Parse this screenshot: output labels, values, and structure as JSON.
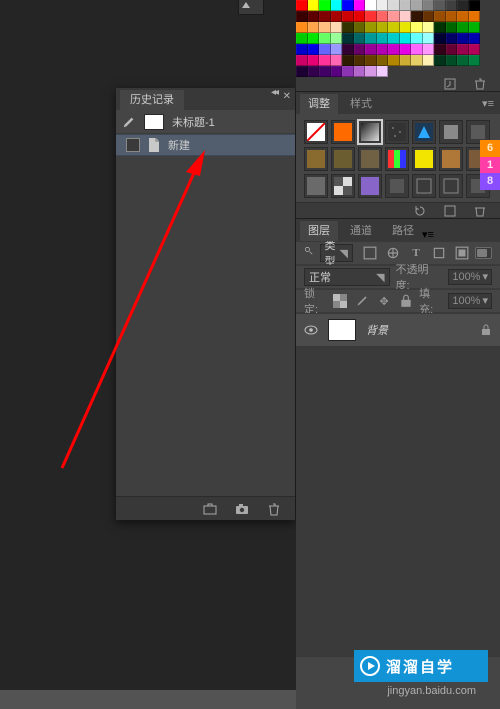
{
  "history": {
    "tab": "历史记录",
    "doc_title": "未标题-1",
    "item": {
      "label": "新建"
    }
  },
  "adjust_tabs": {
    "t1": "调整",
    "t2": "样式"
  },
  "layers_tabs": {
    "t1": "图层",
    "t2": "通道",
    "t3": "路径"
  },
  "filter_row": {
    "label": "类型"
  },
  "blend_row": {
    "mode": "正常",
    "opacity_lbl": "不透明度:",
    "opacity_val": "100%"
  },
  "lock_row": {
    "lbl": "锁定:",
    "fill_lbl": "填充:",
    "fill_val": "100%"
  },
  "layer0": {
    "name": "背景"
  },
  "badge": {
    "a": "6",
    "b": "1",
    "c": "8"
  },
  "brand": {
    "text": "溜溜自学"
  },
  "subbrand": "jingyan.baidu.com",
  "swatch_colors": [
    "#ff0000",
    "#ffff00",
    "#00ff00",
    "#00ffff",
    "#0000ff",
    "#ff00ff",
    "#ffffff",
    "#ededed",
    "#d9d9d9",
    "#c0c0c0",
    "#a6a6a6",
    "#808080",
    "#595959",
    "#404040",
    "#262626",
    "#000000",
    "#3a0000",
    "#5c0000",
    "#800000",
    "#a60000",
    "#cc0000",
    "#e60000",
    "#ff3333",
    "#ff6666",
    "#ff9999",
    "#ffcccc",
    "#331400",
    "#663300",
    "#994d00",
    "#b35900",
    "#cc6600",
    "#e67300",
    "#ff8c1a",
    "#ffa64d",
    "#ffbf80",
    "#ffd9b3",
    "#333300",
    "#666600",
    "#999900",
    "#b3b300",
    "#cccc00",
    "#e6e600",
    "#ffff66",
    "#ffff99",
    "#003300",
    "#006600",
    "#009900",
    "#00b300",
    "#00cc00",
    "#00e600",
    "#66ff66",
    "#99ff99",
    "#003333",
    "#006666",
    "#009999",
    "#00b3b3",
    "#00cccc",
    "#00e6e6",
    "#66ffff",
    "#99ffff",
    "#000033",
    "#000066",
    "#000099",
    "#0000b3",
    "#0000cc",
    "#0000e6",
    "#6666ff",
    "#9999ff",
    "#330033",
    "#660066",
    "#990099",
    "#b300b3",
    "#cc00cc",
    "#e600e6",
    "#ff66ff",
    "#ff99ff",
    "#330019",
    "#660033",
    "#99004d",
    "#b30059",
    "#cc0066",
    "#e60073",
    "#ff3399",
    "#ff66b3",
    "#2e1a00",
    "#4d2e00",
    "#664000",
    "#806000",
    "#b38600",
    "#ccad33",
    "#e6cf66",
    "#fff0b3",
    "#00331a",
    "#004d26",
    "#006633",
    "#008040",
    "#1c0033",
    "#33004d",
    "#400066",
    "#590080",
    "#8c33b3",
    "#b366cc",
    "#d699e6",
    "#f0ccff"
  ],
  "adj_icons": [
    {
      "name": "no-icon",
      "type": "no"
    },
    {
      "name": "solid-icon",
      "type": "solid",
      "fill": "#ff6a00"
    },
    {
      "name": "gradient-icon",
      "type": "grad",
      "sel": true
    },
    {
      "name": "pattern-icon",
      "type": "pattern"
    },
    {
      "name": "brightness-icon",
      "type": "tri",
      "fill": "#2aa9ff"
    },
    {
      "name": "levels-icon",
      "type": "box",
      "fill": "#8a8a8a"
    },
    {
      "name": "curves-icon",
      "type": "box",
      "fill": "#5a5a5a"
    },
    {
      "name": "exposure-icon",
      "type": "solid",
      "fill": "#8a6b2f"
    },
    {
      "name": "vibrance-icon",
      "type": "solid",
      "fill": "#6b5d2f"
    },
    {
      "name": "hue-icon",
      "type": "solid",
      "fill": "#706144"
    },
    {
      "name": "color-balance-icon",
      "type": "hue"
    },
    {
      "name": "bw-icon",
      "type": "solid",
      "fill": "#f2e600"
    },
    {
      "name": "photo-filter-icon",
      "type": "solid",
      "fill": "#b07838"
    },
    {
      "name": "channel-mixer-icon",
      "type": "solid",
      "fill": "#7a5a38"
    },
    {
      "name": "lookup-icon",
      "type": "solid",
      "fill": "#6a6a6a"
    },
    {
      "name": "invert-icon",
      "type": "grid"
    },
    {
      "name": "posterize-icon",
      "type": "solid",
      "fill": "#8866c9"
    },
    {
      "name": "threshold-icon",
      "type": "box",
      "fill": "#555"
    },
    {
      "name": "selective-icon",
      "type": "outline"
    },
    {
      "name": "gradmap-icon",
      "type": "outline"
    },
    {
      "name": "extra-icon",
      "type": "box",
      "fill": "#555"
    }
  ]
}
